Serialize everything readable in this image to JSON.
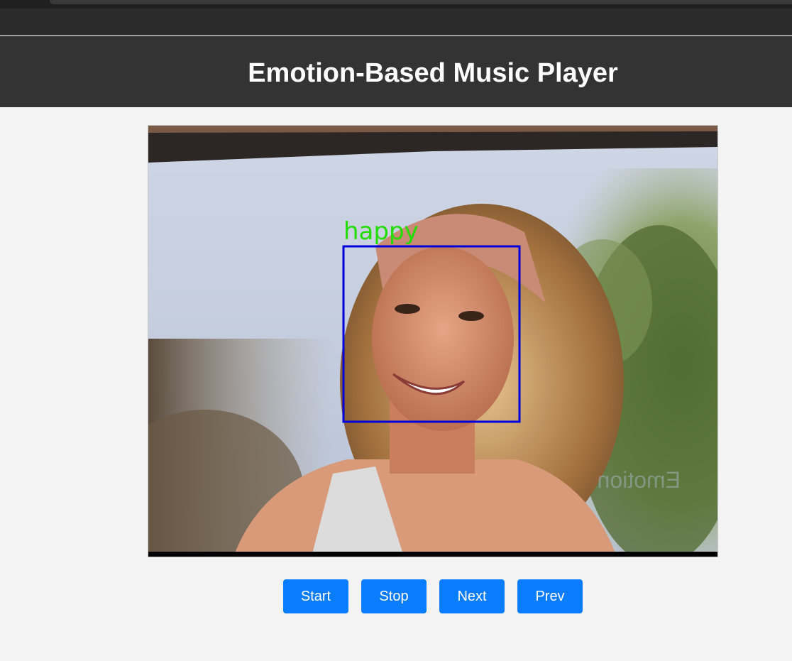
{
  "header": {
    "title": "Emotion-Based Music Player"
  },
  "video": {
    "detected_emotion": "happy",
    "box_color": "#0000dd",
    "label_color": "#22dd00",
    "watermark": "Emotion"
  },
  "controls": {
    "start_label": "Start",
    "stop_label": "Stop",
    "next_label": "Next",
    "prev_label": "Prev"
  },
  "colors": {
    "header_bg": "#333333",
    "button_bg": "#0a7cff",
    "page_bg": "#f3f3f3"
  }
}
